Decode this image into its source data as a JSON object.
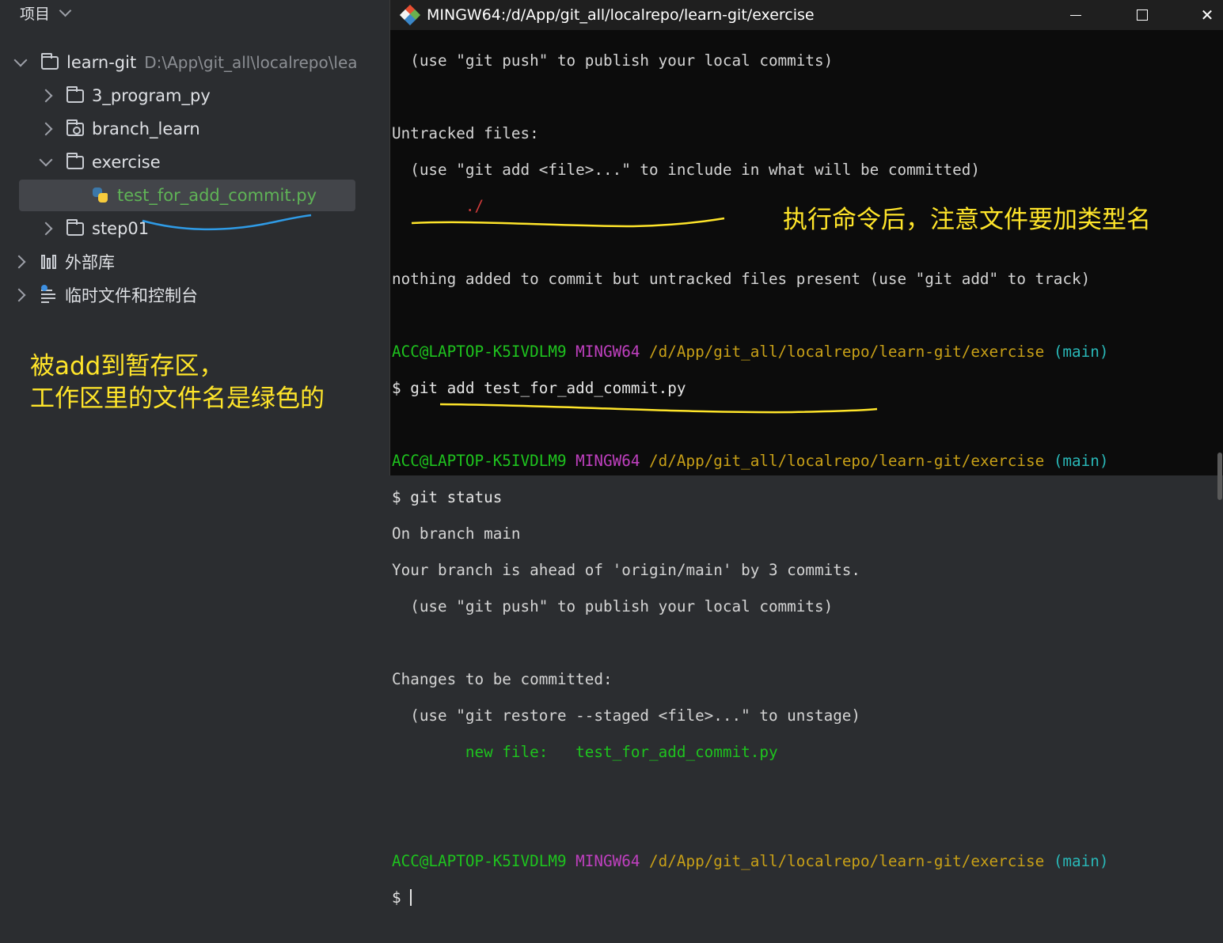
{
  "ide": {
    "header": "项目",
    "tree": {
      "root_name": "learn-git",
      "root_path": "D:\\App\\git_all\\localrepo\\lea",
      "folder_3": "3_program_py",
      "folder_branch": "branch_learn",
      "folder_exercise": "exercise",
      "file_selected": "test_for_add_commit.py",
      "folder_step": "step01",
      "external_libs": "外部库",
      "scratches": "临时文件和控制台"
    },
    "annotation_line1": "被add到暂存区，",
    "annotation_line2": "工作区里的文件名是绿色的"
  },
  "terminal": {
    "title": "MINGW64:/d/App/git_all/localrepo/learn-git/exercise",
    "annotation": "执行命令后，注意文件要加类型名",
    "lines": {
      "l1": "  (use \"git push\" to publish your local commits)",
      "l3": "Untracked files:",
      "l4": "  (use \"git add <file>...\" to include in what will be committed)",
      "l5": "        ./",
      "l7": "nothing added to commit but untracked files present (use \"git add\" to track)",
      "prompt_user": "ACC@LAPTOP-K5IVDLM9",
      "prompt_shell": "MINGW64",
      "prompt_path": "/d/App/git_all/localrepo/learn-git/exercise",
      "prompt_branch": "(main)",
      "cmd1": "$ git add test_for_add_commit.py",
      "cmd2": "$ git status",
      "l_on_branch": "On branch main",
      "l_ahead": "Your branch is ahead of 'origin/main' by 3 commits.",
      "l_push": "  (use \"git push\" to publish your local commits)",
      "l_changes": "Changes to be committed:",
      "l_restore": "  (use \"git restore --staged <file>...\" to unstage)",
      "l_newfile": "        new file:   test_for_add_commit.py",
      "cmd3": "$ "
    }
  },
  "colors": {
    "annotation": "#ffe52a",
    "staged_file": "#1ec31e",
    "underline_ide": "#2f9be6"
  }
}
